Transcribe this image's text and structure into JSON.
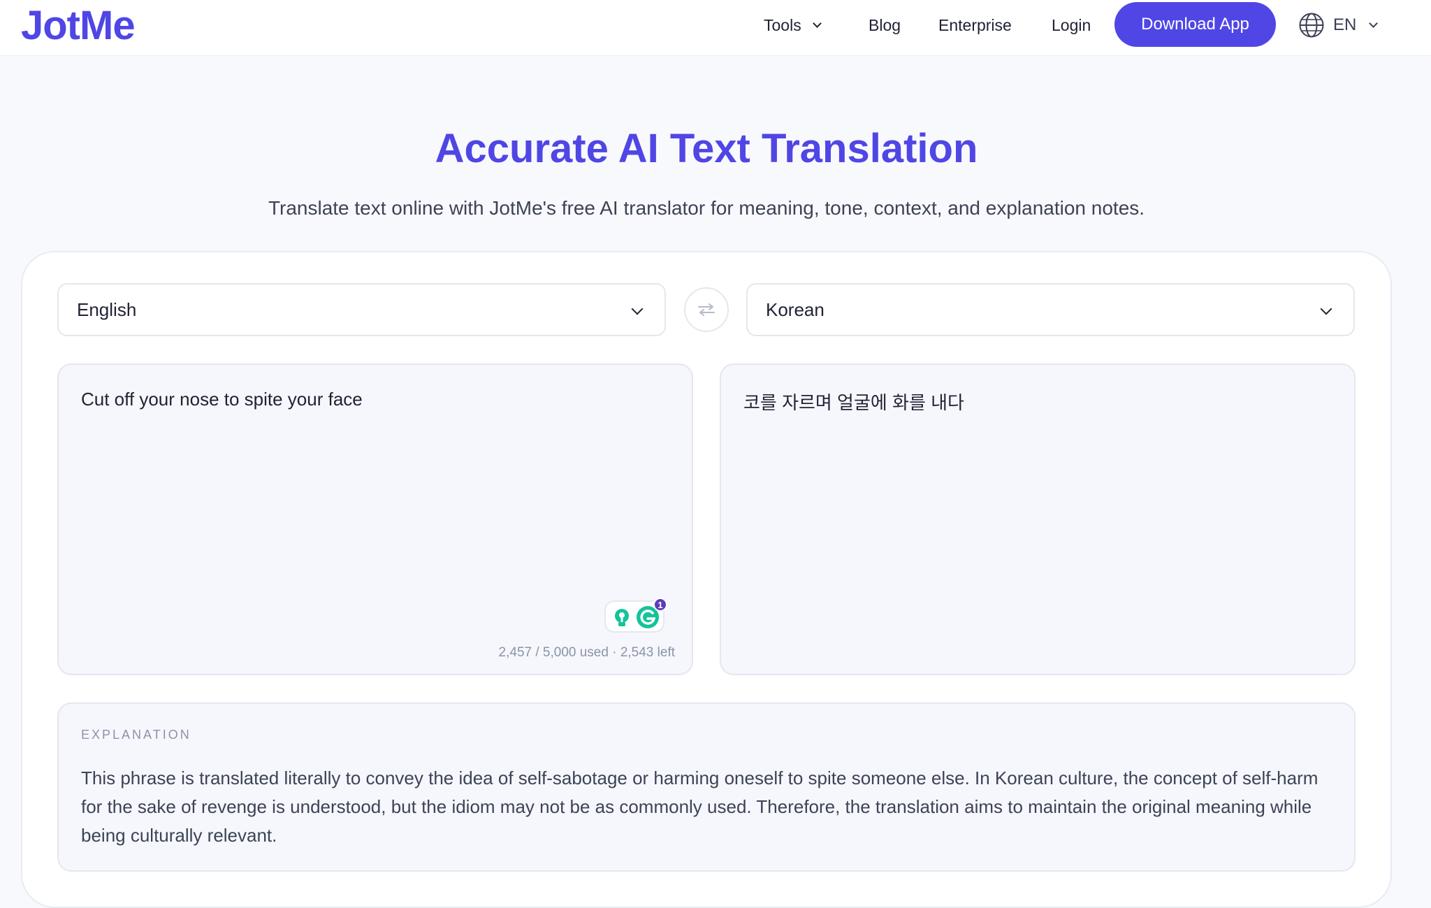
{
  "header": {
    "logo": "JotMe",
    "nav": {
      "tools": "Tools",
      "blog": "Blog",
      "enterprise": "Enterprise",
      "login": "Login"
    },
    "download_label": "Download App",
    "language_code": "EN"
  },
  "hero": {
    "title": "Accurate AI Text Translation",
    "subtitle": "Translate text online with JotMe's free AI translator for meaning, tone, context, and explanation notes."
  },
  "translator": {
    "source_language": "English",
    "target_language": "Korean",
    "source_text": "Cut off your nose to spite your face",
    "target_text": "코를 자르며 얼굴에 화를 내다",
    "usage_counter": "2,457 / 5,000 used · 2,543 left",
    "grammarly_badge_count": "1"
  },
  "explanation": {
    "label": "EXPLANATION",
    "text": "This phrase is translated literally to convey the idea of self-sabotage or harming oneself to spite someone else. In Korean culture, the concept of self-harm for the sake of revenge is understood, but the idiom may not be as commonly used. Therefore, the translation aims to maintain the original meaning while being culturally relevant."
  },
  "colors": {
    "brand": "#4f46e5",
    "page_background": "#f8f9fd",
    "panel_background": "#f6f7fd",
    "grammarly_green": "#15c39a",
    "badge_purple": "#5b3db8"
  },
  "icons": {
    "tools_dropdown": "chevron-down-icon",
    "language": "globe-icon",
    "swap": "swap-arrows-icon",
    "select": "chevron-down-icon",
    "extension": "grammarly-icon"
  }
}
